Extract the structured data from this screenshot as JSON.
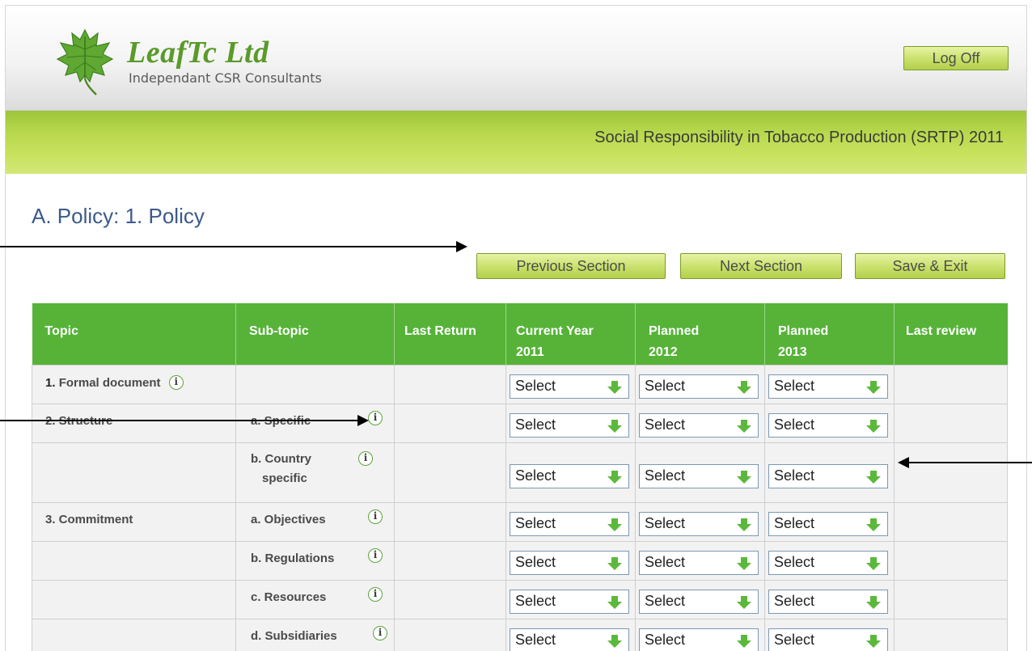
{
  "header": {
    "brand_name": "LeafTc Ltd",
    "brand_tagline": "Independant CSR Consultants",
    "logoff_label": "Log Off"
  },
  "banner": {
    "title": "Social Responsibility in Tobacco Production (SRTP) 2011"
  },
  "page": {
    "title": "A. Policy: 1. Policy"
  },
  "toolbar": {
    "prev_label": "Previous Section",
    "next_label": "Next Section",
    "save_label": "Save & Exit"
  },
  "table": {
    "headers": {
      "topic": "Topic",
      "subtopic": "Sub-topic",
      "last_return": "Last Return",
      "current_line1": "Current Year",
      "current_line2": "2011",
      "planned1_line1": "Planned",
      "planned1_line2": "2012",
      "planned2_line1": "Planned",
      "planned2_line2": "2013",
      "last_review": "Last review"
    },
    "rows": [
      {
        "topic_num": "1.",
        "topic": "Formal document",
        "subtopic": ""
      },
      {
        "topic": "2. Structure",
        "subtopic": "a. Specific"
      },
      {
        "topic": "",
        "subtopic_line1": "b. Country",
        "subtopic_line2": "specific"
      },
      {
        "topic": "3. Commitment",
        "subtopic": "a. Objectives"
      },
      {
        "topic": "",
        "subtopic": "b. Regulations"
      },
      {
        "topic": "",
        "subtopic": "c. Resources"
      },
      {
        "topic": "",
        "subtopic": "d. Subsidiaries"
      }
    ],
    "select_value": "Select",
    "info_glyph": "i"
  },
  "colors": {
    "accent_green": "#56b338",
    "title_blue": "#3b5a8a",
    "button_green": "#c9e06a"
  },
  "icons": [
    "leaf-logo-icon",
    "info-icon",
    "dropdown-arrow-icon"
  ]
}
